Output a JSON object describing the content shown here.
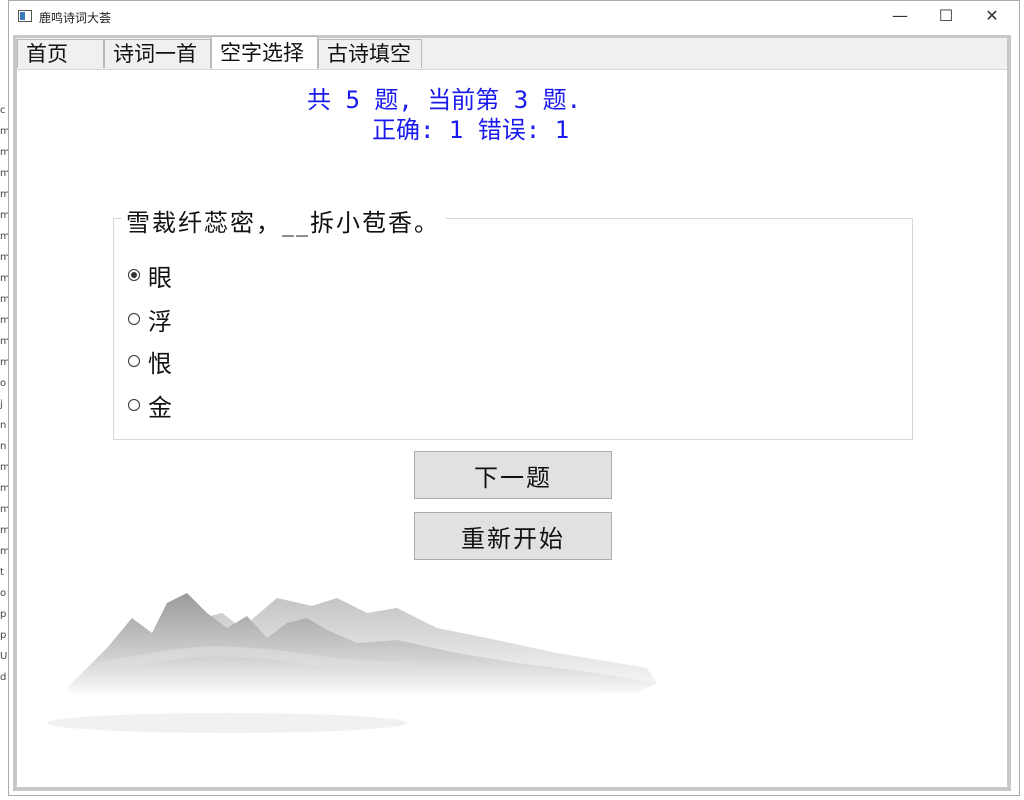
{
  "window": {
    "title": "鹿鸣诗词大荟",
    "controls": {
      "minimize": "—",
      "maximize": "☐",
      "close": "✕"
    }
  },
  "tabs": [
    {
      "label": "首页",
      "active": false
    },
    {
      "label": "诗词一首",
      "active": false
    },
    {
      "label": "空字选择",
      "active": true
    },
    {
      "label": "古诗填空",
      "active": false
    }
  ],
  "progress": {
    "line1": "共 5 题, 当前第 3 题.",
    "line2": "正确: 1 错误: 1"
  },
  "question": {
    "text": "雪裁纤蕊密，__拆小苞香。",
    "options": [
      {
        "label": "眼",
        "selected": true
      },
      {
        "label": "浮",
        "selected": false
      },
      {
        "label": "恨",
        "selected": false
      },
      {
        "label": "金",
        "selected": false
      }
    ]
  },
  "buttons": {
    "next": "下一题",
    "restart": "重新开始"
  },
  "colors": {
    "progress_text": "#1a1aee",
    "button_bg": "#e1e1e1",
    "frame_border": "#c8c8c8"
  }
}
